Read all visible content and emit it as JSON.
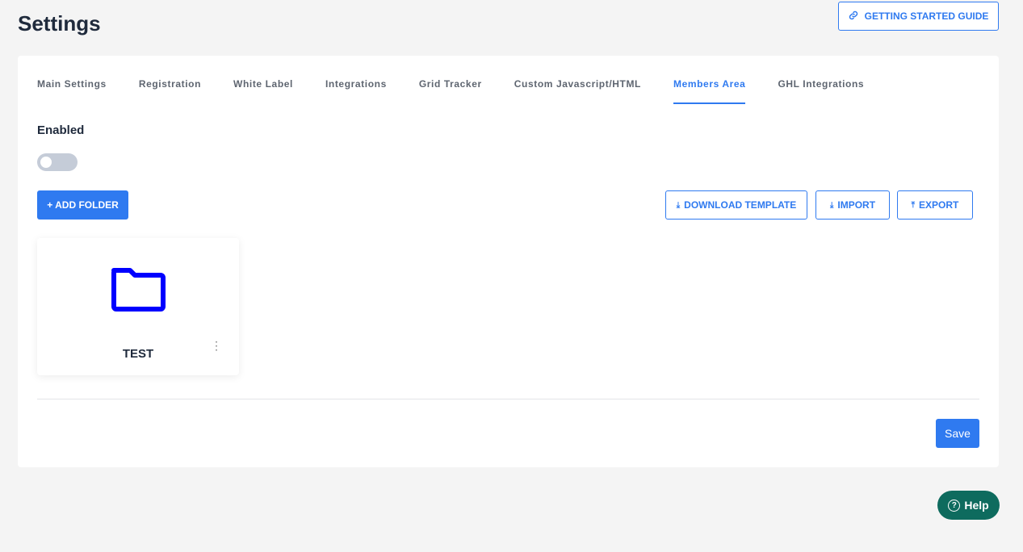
{
  "header": {
    "title": "Settings",
    "guide_label": "GETTING STARTED GUIDE",
    "guide_icon": "link-icon"
  },
  "tabs": [
    {
      "label": "Main Settings"
    },
    {
      "label": "Registration"
    },
    {
      "label": "White Label"
    },
    {
      "label": "Integrations"
    },
    {
      "label": "Grid Tracker"
    },
    {
      "label": "Custom Javascript/HTML"
    },
    {
      "label": "Members Area",
      "active": true
    },
    {
      "label": "GHL Integrations"
    }
  ],
  "members_area": {
    "enabled_label": "Enabled",
    "enabled": false,
    "add_folder_label": "+ ADD FOLDER",
    "download_template_label": "DOWNLOAD TEMPLATE",
    "import_label": "IMPORT",
    "export_label": "EXPORT",
    "folders": [
      {
        "name": "TEST",
        "icon": "folder-icon"
      }
    ]
  },
  "footer": {
    "save_label": "Save",
    "help_label": "Help"
  },
  "colors": {
    "accent": "#2f7af0",
    "folder": "#0000ff",
    "help": "#0e6b5e"
  }
}
